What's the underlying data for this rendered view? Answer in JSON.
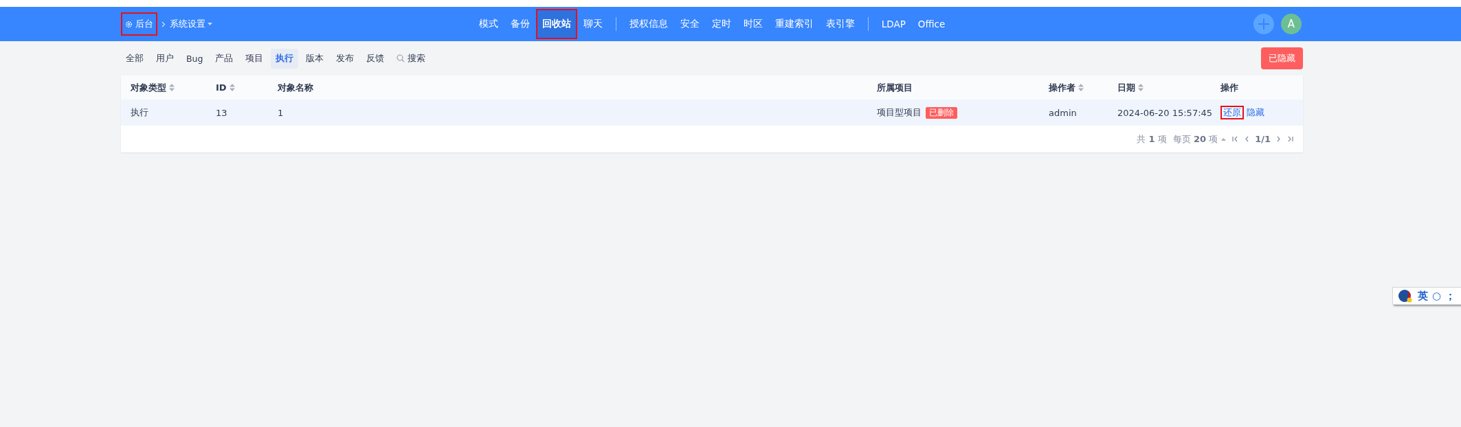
{
  "header": {
    "home": {
      "label": "后台",
      "highlighted": true
    },
    "breadcrumb": {
      "label": "系统设置"
    },
    "nav_groups": [
      [
        {
          "label": "模式",
          "selected": false,
          "highlighted": false
        },
        {
          "label": "备份",
          "selected": false,
          "highlighted": false
        },
        {
          "label": "回收站",
          "selected": true,
          "highlighted": true
        },
        {
          "label": "聊天",
          "selected": false,
          "highlighted": false
        }
      ],
      [
        {
          "label": "授权信息",
          "selected": false,
          "highlighted": false
        },
        {
          "label": "安全",
          "selected": false,
          "highlighted": false
        },
        {
          "label": "定时",
          "selected": false,
          "highlighted": false
        },
        {
          "label": "时区",
          "selected": false,
          "highlighted": false
        },
        {
          "label": "重建索引",
          "selected": false,
          "highlighted": false
        },
        {
          "label": "表引擎",
          "selected": false,
          "highlighted": false
        }
      ],
      [
        {
          "label": "LDAP",
          "selected": false,
          "highlighted": false
        },
        {
          "label": "Office",
          "selected": false,
          "highlighted": false
        }
      ]
    ],
    "avatar": {
      "initial": "A"
    }
  },
  "filters": [
    {
      "label": "全部",
      "kind": "tab",
      "selected": false
    },
    {
      "label": "用户",
      "kind": "tab",
      "selected": false
    },
    {
      "label": "Bug",
      "kind": "tab",
      "selected": false
    },
    {
      "label": "产品",
      "kind": "tab",
      "selected": false
    },
    {
      "label": "项目",
      "kind": "tab",
      "selected": false
    },
    {
      "label": "执行",
      "kind": "tab",
      "selected": true
    },
    {
      "label": "版本",
      "kind": "tab",
      "selected": false
    },
    {
      "label": "发布",
      "kind": "tab",
      "selected": false
    },
    {
      "label": "反馈",
      "kind": "tab",
      "selected": false
    },
    {
      "label": "搜索",
      "kind": "search",
      "selected": false
    }
  ],
  "hidden_button": {
    "label": "已隐藏"
  },
  "table": {
    "columns": [
      {
        "label": "对象类型",
        "sortable": true
      },
      {
        "label": "ID",
        "sortable": true
      },
      {
        "label": "对象名称",
        "sortable": false
      },
      {
        "label": "所属项目",
        "sortable": false
      },
      {
        "label": "操作者",
        "sortable": true
      },
      {
        "label": "日期",
        "sortable": true
      },
      {
        "label": "操作",
        "sortable": false
      }
    ],
    "rows": [
      {
        "type": "执行",
        "id": "13",
        "name": "1",
        "project": "项目型项目",
        "project_badge": "已删除",
        "operator": "admin",
        "date": "2024-06-20 15:57:45",
        "actions": [
          {
            "label": "还原",
            "highlighted": true
          },
          {
            "label": "隐藏",
            "highlighted": false
          }
        ]
      }
    ]
  },
  "pagination": {
    "total": "共 **1** 项",
    "per_page": "每页 **20** 项",
    "page": "1/1"
  },
  "ime_bar": {
    "items": [
      "英",
      "○",
      "；"
    ]
  }
}
